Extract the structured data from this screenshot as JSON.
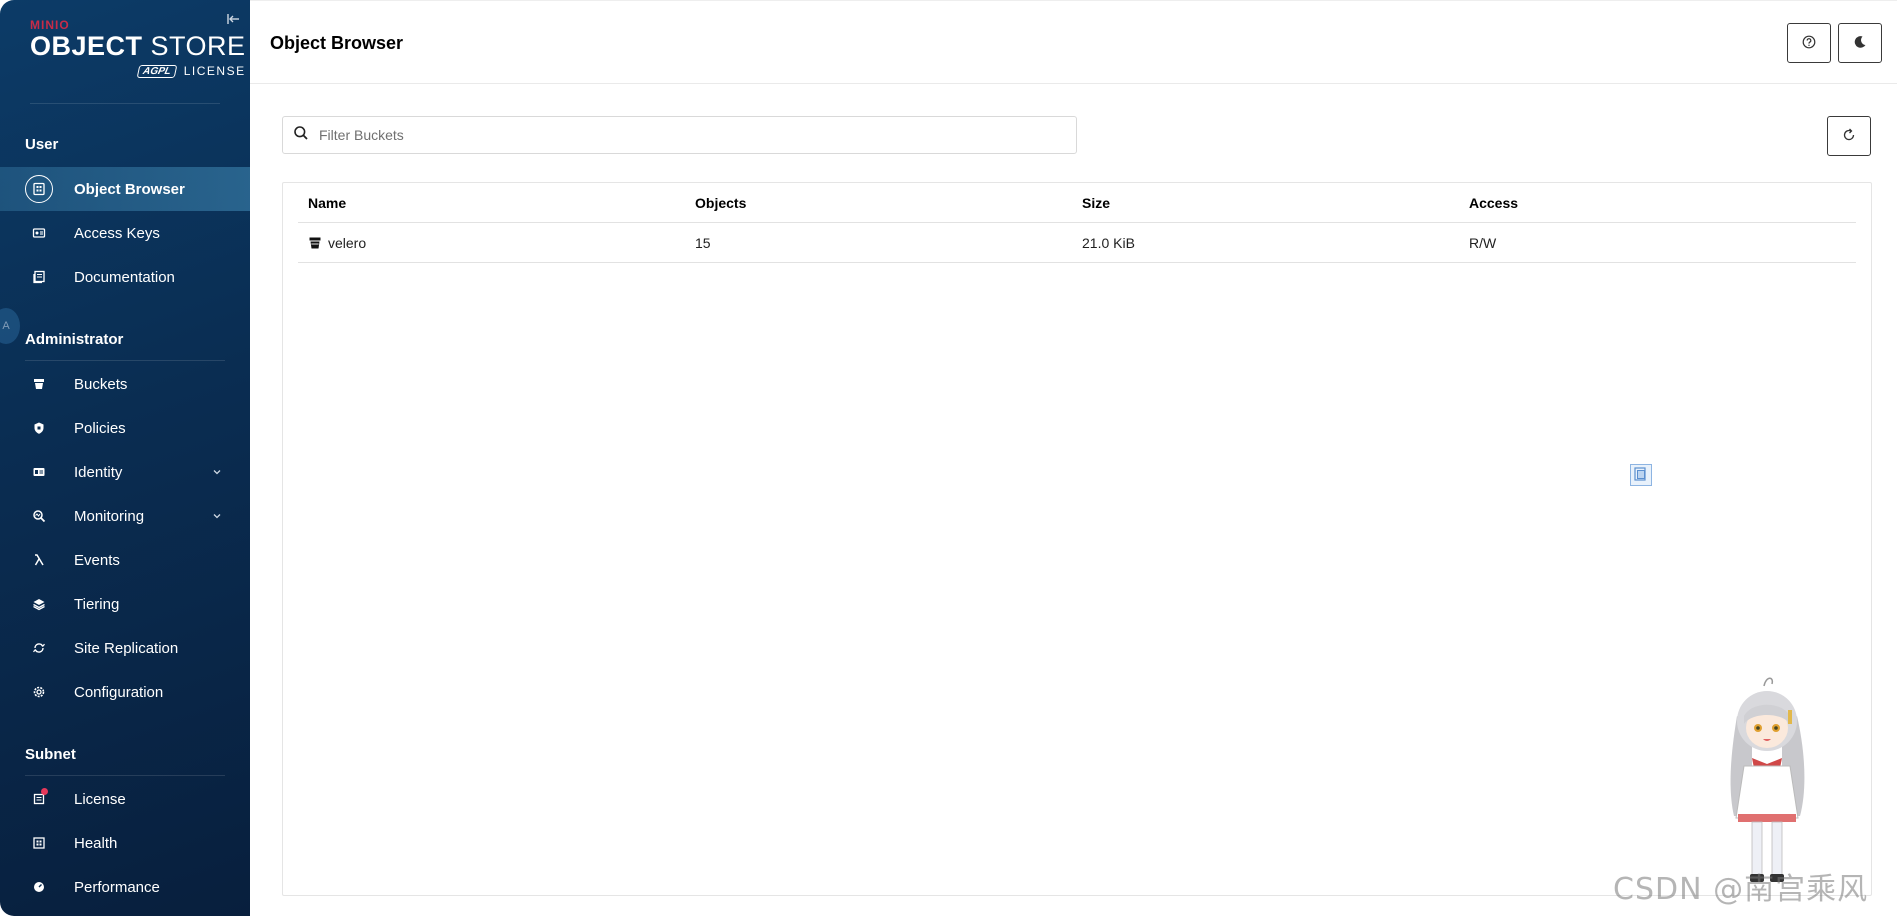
{
  "brand": {
    "vendor": "MINIO",
    "product_bold": "OBJECT",
    "product_light": "STORE",
    "license_badge": "AGPL",
    "license_label": "LICENSE"
  },
  "sidebar": {
    "sections": [
      {
        "title": "User",
        "items": [
          {
            "label": "Object Browser",
            "icon": "object-browser-icon",
            "active": true
          },
          {
            "label": "Access Keys",
            "icon": "access-keys-icon"
          },
          {
            "label": "Documentation",
            "icon": "documentation-icon"
          }
        ]
      },
      {
        "title": "Administrator",
        "items": [
          {
            "label": "Buckets",
            "icon": "bucket-icon"
          },
          {
            "label": "Policies",
            "icon": "shield-icon"
          },
          {
            "label": "Identity",
            "icon": "identity-icon",
            "expandable": true
          },
          {
            "label": "Monitoring",
            "icon": "monitoring-icon",
            "expandable": true
          },
          {
            "label": "Events",
            "icon": "lambda-icon"
          },
          {
            "label": "Tiering",
            "icon": "layers-icon"
          },
          {
            "label": "Site Replication",
            "icon": "replication-icon"
          },
          {
            "label": "Configuration",
            "icon": "gear-icon"
          }
        ]
      },
      {
        "title": "Subnet",
        "items": [
          {
            "label": "License",
            "icon": "license-icon",
            "badge": true
          },
          {
            "label": "Health",
            "icon": "health-icon"
          },
          {
            "label": "Performance",
            "icon": "performance-icon"
          }
        ]
      }
    ]
  },
  "header": {
    "title": "Object Browser",
    "help_icon": "help-icon",
    "theme_icon": "moon-icon"
  },
  "search": {
    "placeholder": "Filter Buckets",
    "value": ""
  },
  "table": {
    "columns": [
      "Name",
      "Objects",
      "Size",
      "Access"
    ],
    "rows": [
      {
        "name": "velero",
        "objects": "15",
        "size": "21.0 KiB",
        "access": "R/W"
      }
    ]
  },
  "watermark": "CSDN @南宫乘风",
  "colors": {
    "sidebar_bg": "#0a2d52",
    "active_item_bg": "#2e6c96",
    "brand_red": "#c72c48",
    "badge_red": "#e5385a"
  }
}
